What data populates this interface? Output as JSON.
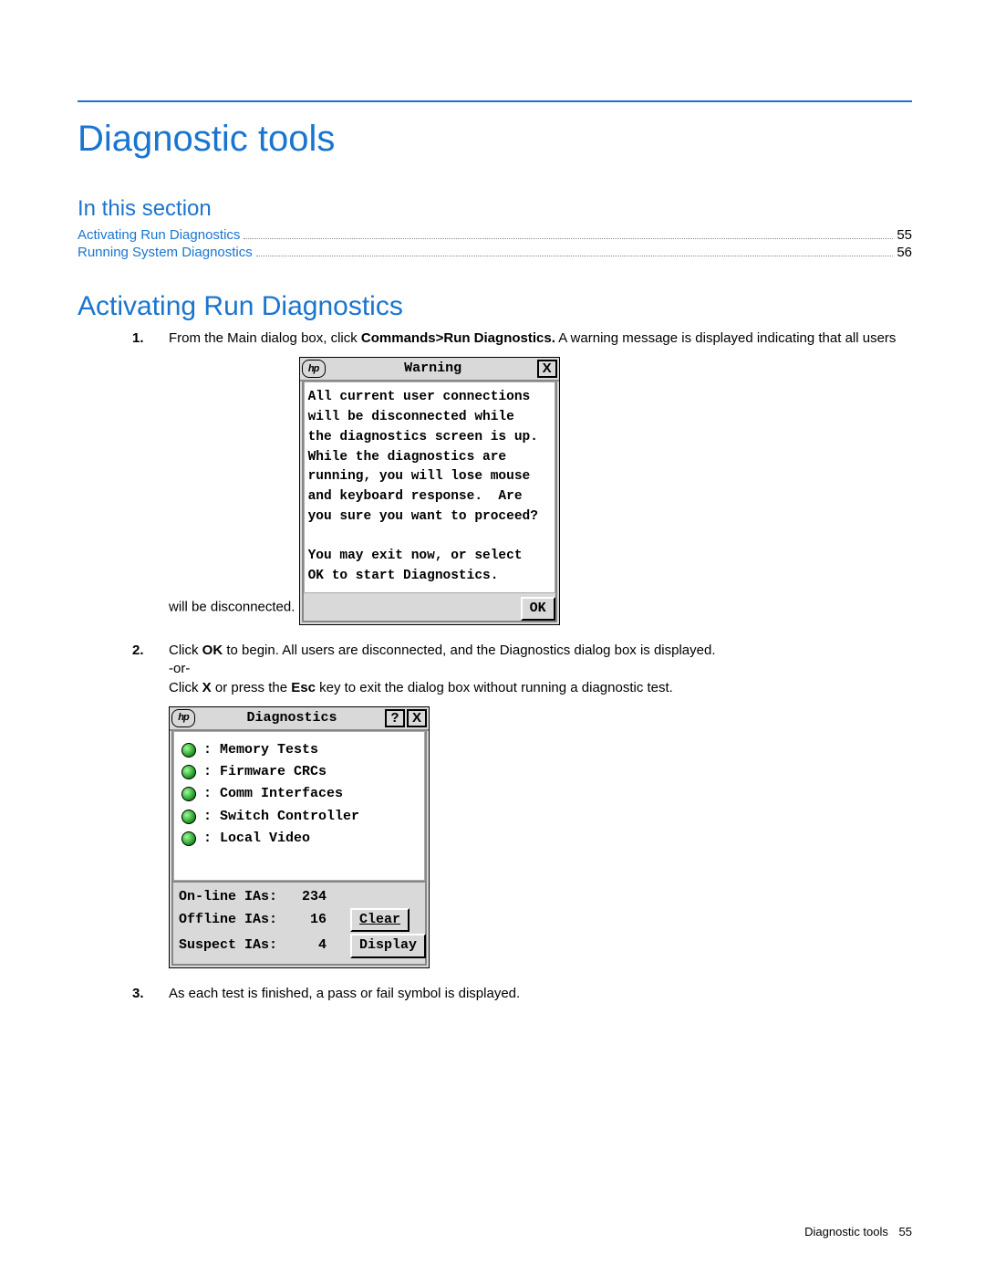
{
  "chapter_title": "Diagnostic tools",
  "section_label": "In this section",
  "toc": [
    {
      "label": "Activating Run Diagnostics ",
      "page": "55"
    },
    {
      "label": "Running System Diagnostics",
      "page": "56"
    }
  ],
  "h2": "Activating Run Diagnostics",
  "steps": {
    "s1": {
      "num": "1.",
      "pre": "From the Main dialog box, click ",
      "bold": "Commands>Run Diagnostics.",
      "post": " A warning message is displayed indicating that all users will be disconnected."
    },
    "s2": {
      "num": "2.",
      "line1_pre": "Click ",
      "line1_bold": "OK",
      "line1_post": " to begin. All users are disconnected, and the Diagnostics dialog box is displayed.",
      "or": "-or-",
      "line2_pre": "Click ",
      "line2_bold1": "X",
      "line2_mid": " or press the ",
      "line2_bold2": "Esc",
      "line2_post": " key to exit the dialog box without running a diagnostic test."
    },
    "s3": {
      "num": "3.",
      "text": "As each test is finished, a pass or fail symbol is displayed."
    }
  },
  "warning_dialog": {
    "logo": "hp",
    "title": "Warning",
    "close": "X",
    "body": "All current user connections\nwill be disconnected while\nthe diagnostics screen is up.\nWhile the diagnostics are\nrunning, you will lose mouse\nand keyboard response.  Are\nyou sure you want to proceed?\n\nYou may exit now, or select\nOK to start Diagnostics.",
    "ok": "OK"
  },
  "diag_dialog": {
    "logo": "hp",
    "title": "Diagnostics",
    "help": "?",
    "close": "X",
    "tests": [
      ": Memory Tests",
      ": Firmware CRCs",
      ": Comm Interfaces",
      ": Switch Controller",
      ": Local Video"
    ],
    "ia": {
      "online_label": "On-line IAs:",
      "online_val": "234",
      "offline_label": "Offline IAs:",
      "offline_val": "16",
      "suspect_label": "Suspect IAs:",
      "suspect_val": "4",
      "clear": "Clear",
      "display": "Display"
    }
  },
  "footer": {
    "label": "Diagnostic tools",
    "page": "55"
  }
}
